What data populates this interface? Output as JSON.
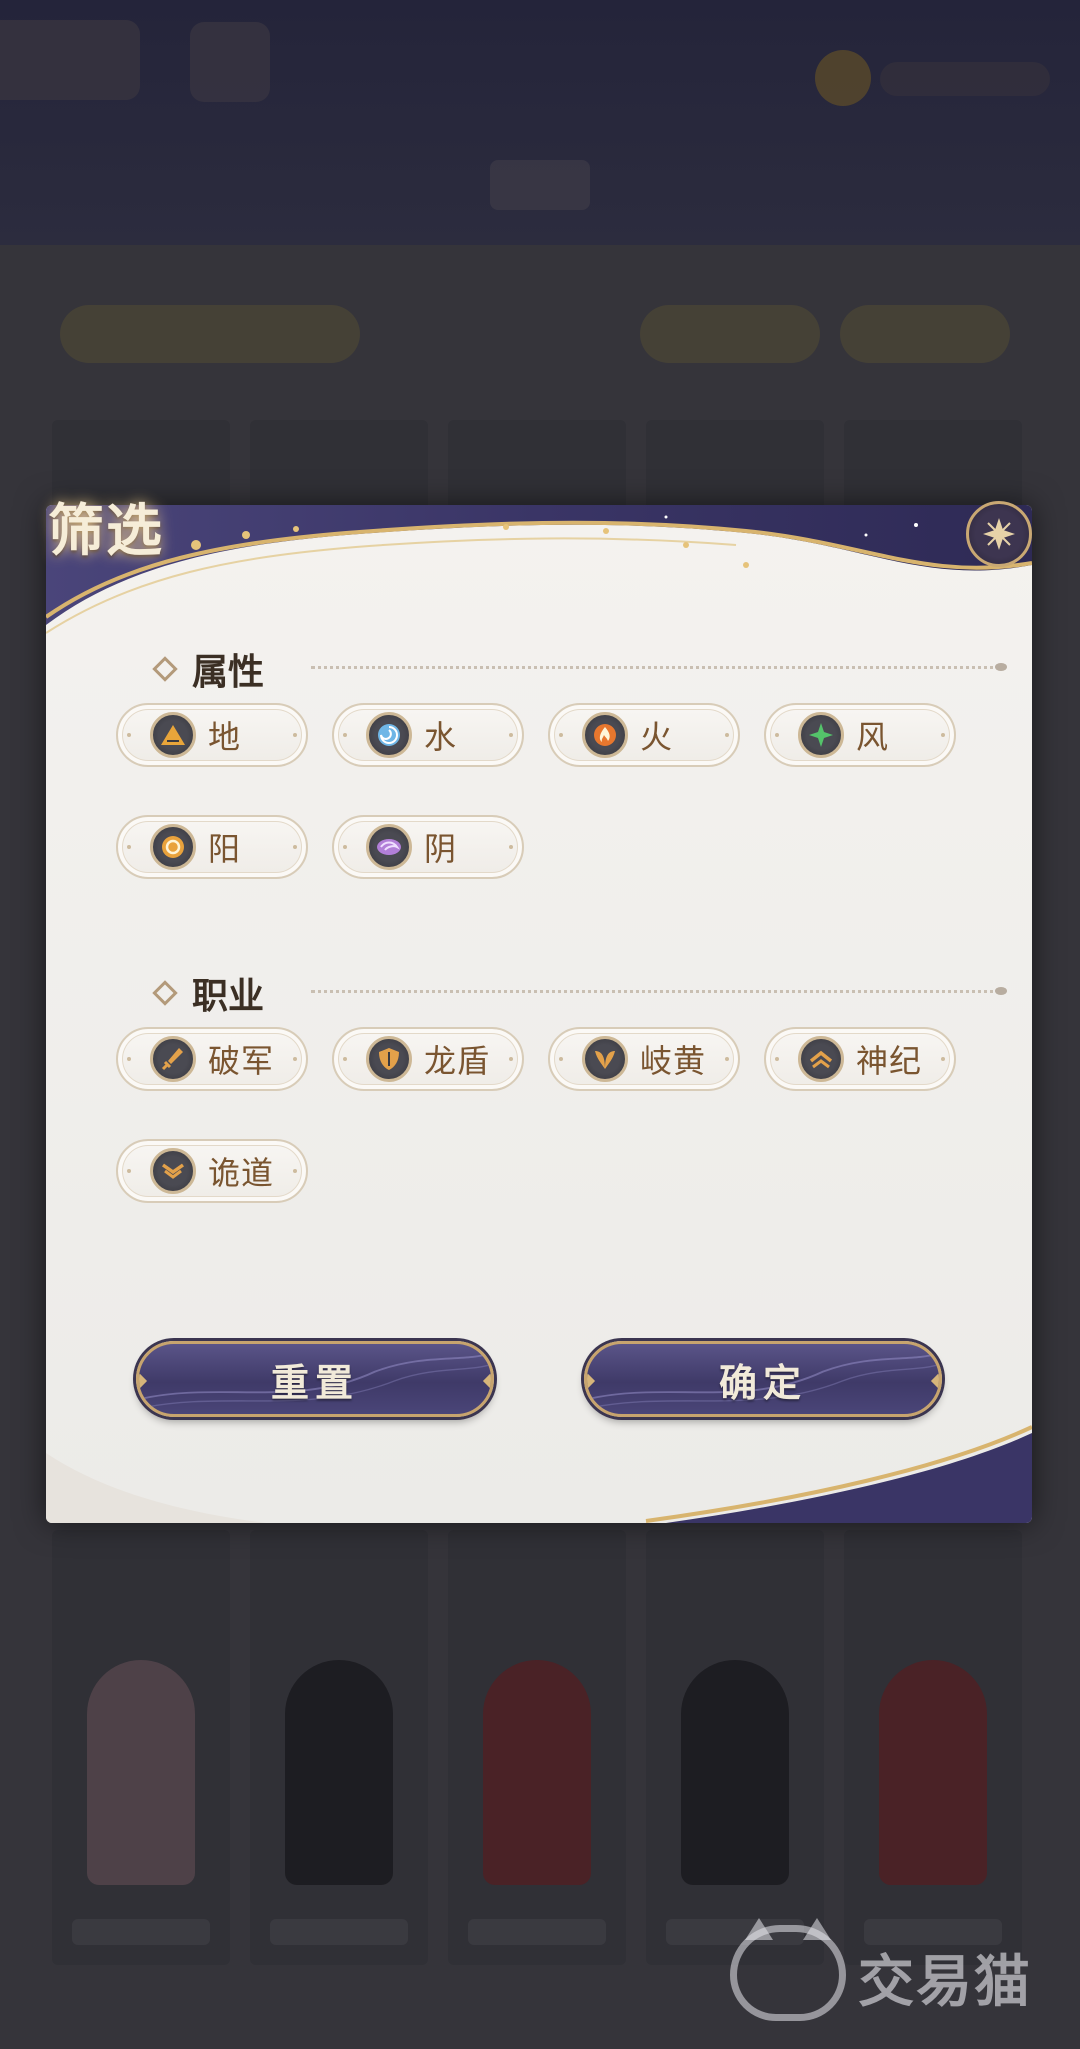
{
  "dialog": {
    "title": "筛选",
    "sections": [
      {
        "title": "属性",
        "options": [
          {
            "label": "地",
            "icon": "earth-icon",
            "color": "#e8a53a"
          },
          {
            "label": "水",
            "icon": "water-icon",
            "color": "#6fb6e6"
          },
          {
            "label": "火",
            "icon": "fire-icon",
            "color": "#e8772e"
          },
          {
            "label": "风",
            "icon": "wind-icon",
            "color": "#54c36a"
          },
          {
            "label": "阳",
            "icon": "sun-icon",
            "color": "#e9a23c"
          },
          {
            "label": "阴",
            "icon": "moon-icon",
            "color": "#b27fd8"
          }
        ]
      },
      {
        "title": "职业",
        "options": [
          {
            "label": "破军",
            "icon": "sword-icon",
            "color": "#e3a14a"
          },
          {
            "label": "龙盾",
            "icon": "shield-icon",
            "color": "#e3a14a"
          },
          {
            "label": "岐黄",
            "icon": "healer-icon",
            "color": "#e3a14a"
          },
          {
            "label": "神纪",
            "icon": "chevron-up-icon",
            "color": "#e3a14a"
          },
          {
            "label": "诡道",
            "icon": "chevron-down-double-icon",
            "color": "#e3a14a"
          }
        ]
      }
    ],
    "buttons": {
      "reset": "重置",
      "confirm": "确定"
    }
  },
  "watermark": {
    "text": "交易猫",
    "icon": "cat-logo-icon"
  },
  "colors": {
    "accent_purple": "#3f3a68",
    "gold": "#c7a46e",
    "chip_text": "#7a5530"
  }
}
